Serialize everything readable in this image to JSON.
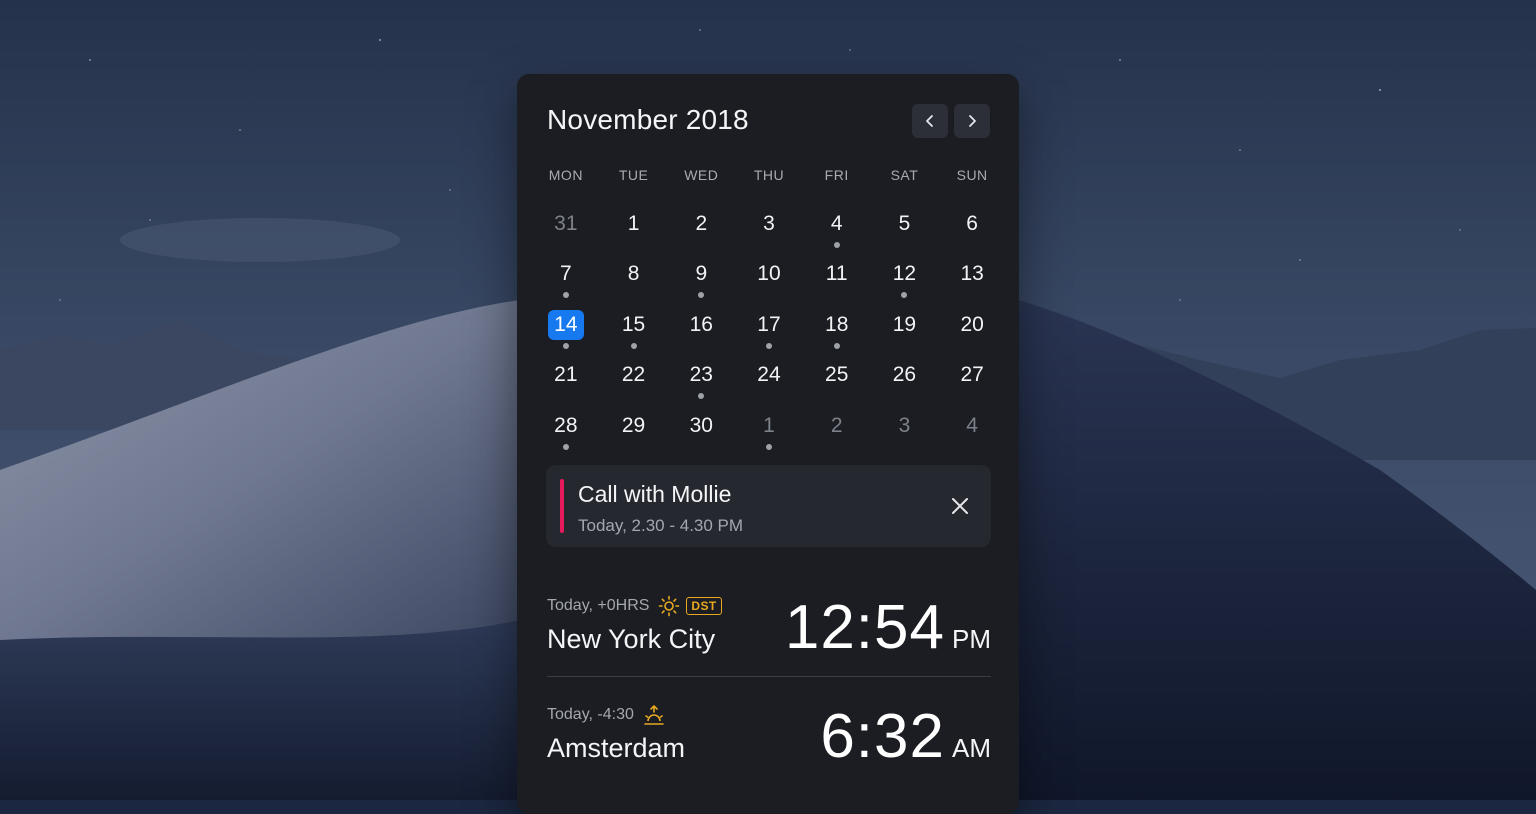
{
  "calendar": {
    "month_title": "November 2018",
    "weekdays": [
      "MON",
      "TUE",
      "WED",
      "THU",
      "FRI",
      "SAT",
      "SUN"
    ],
    "days": [
      {
        "label": "31",
        "muted": true,
        "event": false
      },
      {
        "label": "1",
        "muted": false,
        "event": false
      },
      {
        "label": "2",
        "muted": false,
        "event": false
      },
      {
        "label": "3",
        "muted": false,
        "event": false
      },
      {
        "label": "4",
        "muted": false,
        "event": true
      },
      {
        "label": "5",
        "muted": false,
        "event": false
      },
      {
        "label": "6",
        "muted": false,
        "event": false
      },
      {
        "label": "7",
        "muted": false,
        "event": true
      },
      {
        "label": "8",
        "muted": false,
        "event": false
      },
      {
        "label": "9",
        "muted": false,
        "event": true
      },
      {
        "label": "10",
        "muted": false,
        "event": false
      },
      {
        "label": "11",
        "muted": false,
        "event": false
      },
      {
        "label": "12",
        "muted": false,
        "event": true
      },
      {
        "label": "13",
        "muted": false,
        "event": false
      },
      {
        "label": "14",
        "muted": false,
        "event": true,
        "selected": true
      },
      {
        "label": "15",
        "muted": false,
        "event": true
      },
      {
        "label": "16",
        "muted": false,
        "event": false
      },
      {
        "label": "17",
        "muted": false,
        "event": true
      },
      {
        "label": "18",
        "muted": false,
        "event": true
      },
      {
        "label": "19",
        "muted": false,
        "event": false
      },
      {
        "label": "20",
        "muted": false,
        "event": false
      },
      {
        "label": "21",
        "muted": false,
        "event": false
      },
      {
        "label": "22",
        "muted": false,
        "event": false
      },
      {
        "label": "23",
        "muted": false,
        "event": true
      },
      {
        "label": "24",
        "muted": false,
        "event": false
      },
      {
        "label": "25",
        "muted": false,
        "event": false
      },
      {
        "label": "26",
        "muted": false,
        "event": false
      },
      {
        "label": "27",
        "muted": false,
        "event": false
      },
      {
        "label": "28",
        "muted": false,
        "event": true
      },
      {
        "label": "29",
        "muted": false,
        "event": false
      },
      {
        "label": "30",
        "muted": false,
        "event": false
      },
      {
        "label": "1",
        "muted": true,
        "event": true
      },
      {
        "label": "2",
        "muted": true,
        "event": false
      },
      {
        "label": "3",
        "muted": true,
        "event": false
      },
      {
        "label": "4",
        "muted": true,
        "event": false
      }
    ],
    "prev_icon": "chevron-left-icon",
    "next_icon": "chevron-right-icon"
  },
  "event": {
    "title": "Call with Mollie",
    "time": "Today, 2.30 - 4.30 PM",
    "color": "#e5195b",
    "close_icon": "close-icon"
  },
  "clocks": [
    {
      "meta": "Today, +0HRS",
      "icon": "sun-icon",
      "badge": "DST",
      "city": "New York City",
      "time": "12:54",
      "ampm": "PM"
    },
    {
      "meta": "Today, -4:30",
      "icon": "sunrise-icon",
      "city": "Amsterdam",
      "time": "6:32",
      "ampm": "AM"
    }
  ],
  "colors": {
    "accent": "#1679f0",
    "event": "#e5195b",
    "icon_gold": "#e8a920",
    "panel": "#1b1d23"
  }
}
